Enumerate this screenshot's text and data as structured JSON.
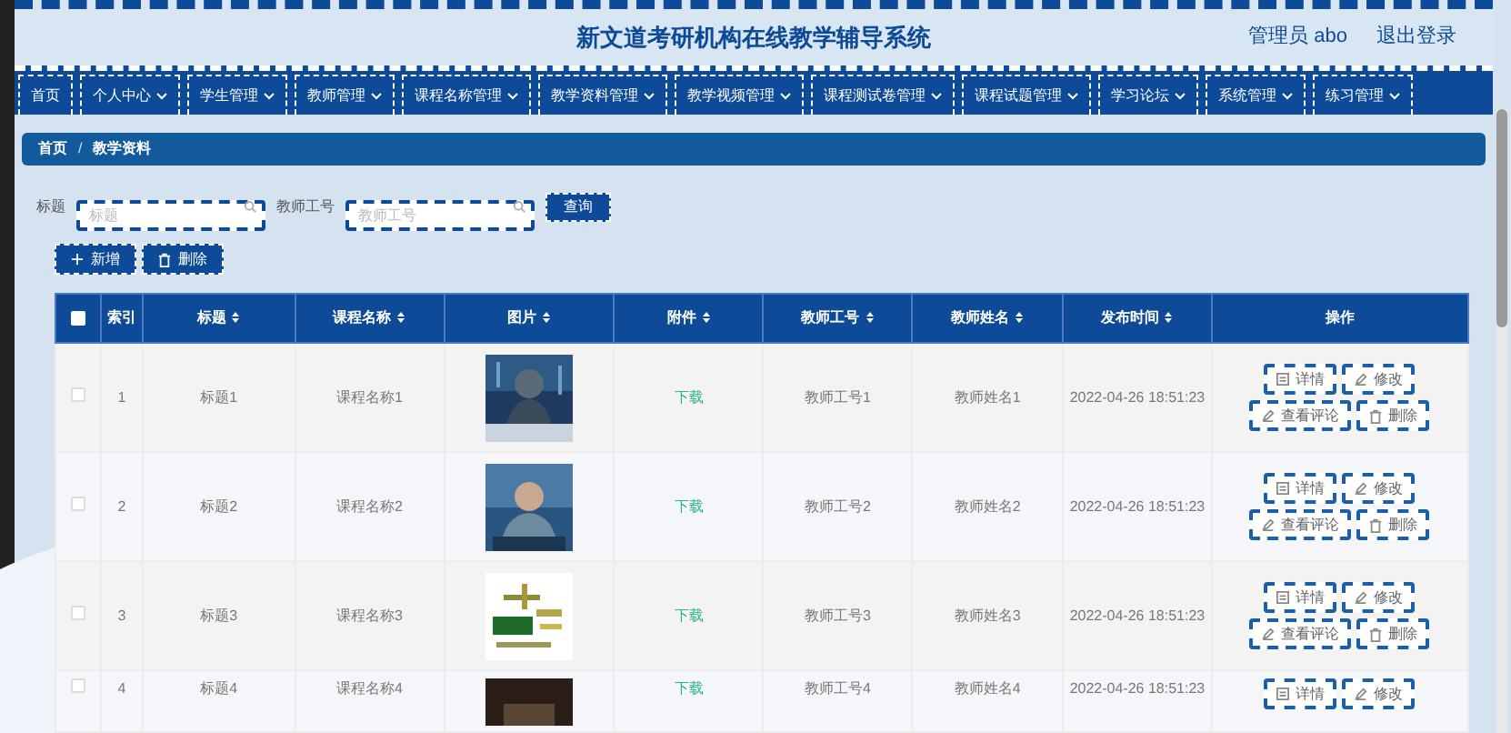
{
  "header": {
    "title": "新文道考研机构在线教学辅导系统",
    "user": "管理员 abo",
    "logout": "退出登录"
  },
  "nav": [
    {
      "label": "首页",
      "dropdown": false
    },
    {
      "label": "个人中心",
      "dropdown": true
    },
    {
      "label": "学生管理",
      "dropdown": true
    },
    {
      "label": "教师管理",
      "dropdown": true
    },
    {
      "label": "课程名称管理",
      "dropdown": true
    },
    {
      "label": "教学资料管理",
      "dropdown": true
    },
    {
      "label": "教学视频管理",
      "dropdown": true
    },
    {
      "label": "课程测试卷管理",
      "dropdown": true
    },
    {
      "label": "课程试题管理",
      "dropdown": true
    },
    {
      "label": "学习论坛",
      "dropdown": true
    },
    {
      "label": "系统管理",
      "dropdown": true
    },
    {
      "label": "练习管理",
      "dropdown": true
    }
  ],
  "breadcrumb": [
    "首页",
    "教学资料"
  ],
  "breadcrumb_separator": "/",
  "search": {
    "fields": [
      {
        "label": "标题",
        "placeholder": "标题"
      },
      {
        "label": "教师工号",
        "placeholder": "教师工号"
      }
    ],
    "button": "查询"
  },
  "toolbar": [
    {
      "kind": "add",
      "label": "新增"
    },
    {
      "kind": "delete",
      "label": "删除"
    }
  ],
  "table": {
    "header_checked": false,
    "columns": [
      {
        "label": "索引",
        "sortable": false
      },
      {
        "label": "标题",
        "sortable": true
      },
      {
        "label": "课程名称",
        "sortable": true
      },
      {
        "label": "图片",
        "sortable": true
      },
      {
        "label": "附件",
        "sortable": true
      },
      {
        "label": "教师工号",
        "sortable": true
      },
      {
        "label": "教师姓名",
        "sortable": true
      },
      {
        "label": "发布时间",
        "sortable": true
      },
      {
        "label": "操作",
        "sortable": false
      }
    ],
    "rows": [
      {
        "checked": false,
        "index": "1",
        "title": "标题1",
        "course": "课程名称1",
        "attachment": "下载",
        "teacher_id": "教师工号1",
        "teacher_name": "教师姓名1",
        "time": "2022-04-26 18:51:23",
        "actions": [
          {
            "kind": "detail",
            "label": "详情"
          },
          {
            "kind": "edit",
            "label": "修改"
          },
          {
            "kind": "comment",
            "label": "查看评论"
          },
          {
            "kind": "delete",
            "label": "删除"
          }
        ]
      },
      {
        "checked": false,
        "index": "2",
        "title": "标题2",
        "course": "课程名称2",
        "attachment": "下载",
        "teacher_id": "教师工号2",
        "teacher_name": "教师姓名2",
        "time": "2022-04-26 18:51:23",
        "actions": [
          {
            "kind": "detail",
            "label": "详情"
          },
          {
            "kind": "edit",
            "label": "修改"
          },
          {
            "kind": "comment",
            "label": "查看评论"
          },
          {
            "kind": "delete",
            "label": "删除"
          }
        ]
      },
      {
        "checked": false,
        "index": "3",
        "title": "标题3",
        "course": "课程名称3",
        "attachment": "下载",
        "teacher_id": "教师工号3",
        "teacher_name": "教师姓名3",
        "time": "2022-04-26 18:51:23",
        "actions": [
          {
            "kind": "detail",
            "label": "详情"
          },
          {
            "kind": "edit",
            "label": "修改"
          },
          {
            "kind": "comment",
            "label": "查看评论"
          },
          {
            "kind": "delete",
            "label": "删除"
          }
        ]
      },
      {
        "checked": false,
        "index": "4",
        "title": "标题4",
        "course": "课程名称4",
        "attachment": "下载",
        "teacher_id": "教师工号4",
        "teacher_name": "教师姓名4",
        "time": "2022-04-26 18:51:23",
        "actions": [
          {
            "kind": "detail",
            "label": "详情"
          },
          {
            "kind": "edit",
            "label": "修改"
          }
        ]
      }
    ]
  }
}
